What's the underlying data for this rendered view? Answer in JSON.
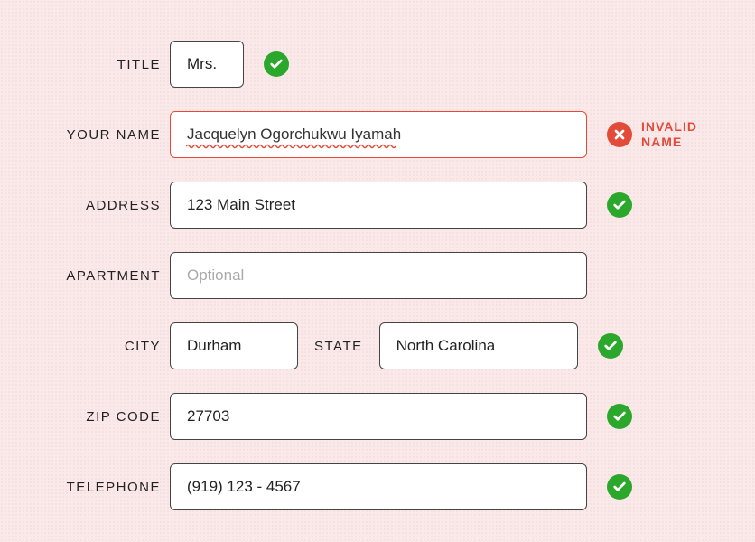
{
  "colors": {
    "accent_ok": "#2ba82b",
    "accent_err": "#e24b3a",
    "bg": "#fbe9e9"
  },
  "labels": {
    "title": "TITLE",
    "name": "YOUR NAME",
    "address": "ADDRESS",
    "apartment": "APARTMENT",
    "city": "CITY",
    "state": "STATE",
    "zip": "ZIP CODE",
    "telephone": "TELEPHONE"
  },
  "values": {
    "title": "Mrs.",
    "name": "Jacquelyn Ogorchukwu Iyamah",
    "address": "123 Main Street",
    "apartment": "",
    "city": "Durham",
    "state": "North Carolina",
    "zip": "27703",
    "telephone": "(919) 123 - 4567"
  },
  "placeholders": {
    "apartment": "Optional"
  },
  "errors": {
    "name": "INVALID NAME"
  },
  "status": {
    "title": "valid",
    "name": "invalid",
    "address": "valid",
    "apartment": "none",
    "city_state": "valid",
    "zip": "valid",
    "telephone": "valid"
  }
}
